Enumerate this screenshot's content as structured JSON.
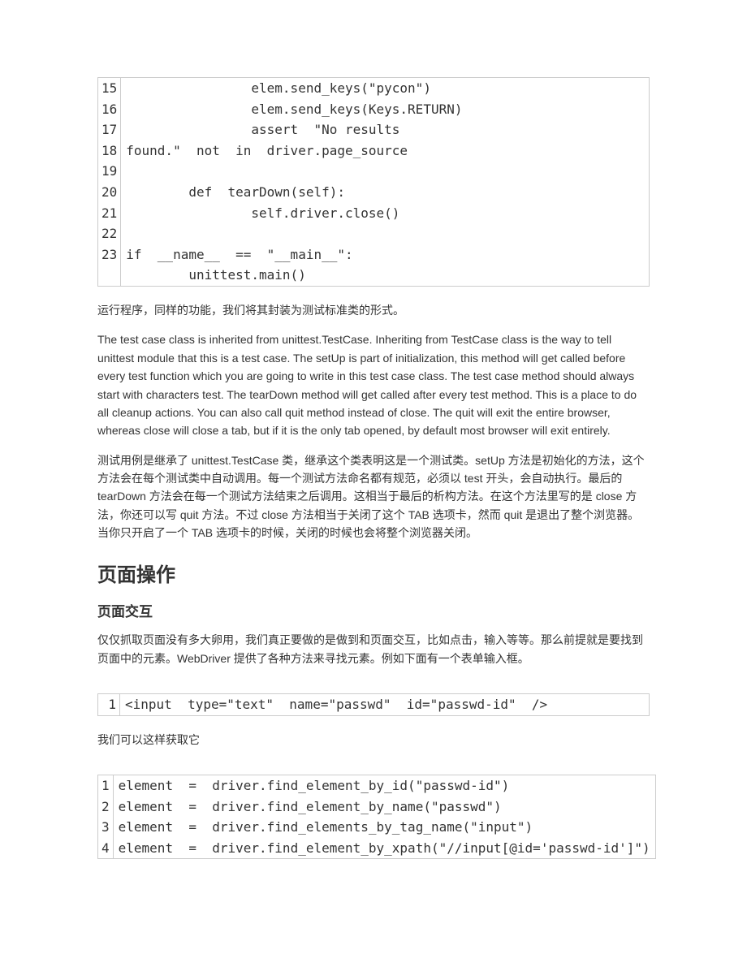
{
  "code1": {
    "start": 15,
    "lines": [
      "                elem.send_keys(\"pycon\")",
      "                elem.send_keys(Keys.RETURN)",
      "                assert  \"No results",
      "found.\"  not  in  driver.page_source",
      "",
      "        def  tearDown(self):",
      "                self.driver.close()",
      "",
      "if  __name__  ==  \"__main__\":",
      "        unittest.main()"
    ]
  },
  "para1": "运行程序，同样的功能，我们将其封装为测试标准类的形式。",
  "para2": "The test case class is inherited from unittest.TestCase. Inheriting from TestCase class is the way to tell unittest module that this is a test case. The setUp is part of initialization, this method will get called before every test function which you are going to write in this test case class. The test case method should always start with characters test. The tearDown method will get called after every test method. This is a place to do all cleanup actions. You can also call quit method instead of close. The quit will exit the entire browser, whereas close will close a tab, but if it is the only tab opened, by default most browser will exit entirely.",
  "para3": "测试用例是继承了 unittest.TestCase 类，继承这个类表明这是一个测试类。setUp 方法是初始化的方法，这个方法会在每个测试类中自动调用。每一个测试方法命名都有规范，必须以 test 开头，会自动执行。最后的 tearDown 方法会在每一个测试方法结束之后调用。这相当于最后的析构方法。在这个方法里写的是 close 方法，你还可以写 quit 方法。不过 close 方法相当于关闭了这个 TAB 选项卡，然而 quit 是退出了整个浏览器。当你只开启了一个 TAB 选项卡的时候，关闭的时候也会将整个浏览器关闭。",
  "h2a": "页面操作",
  "h3a": "页面交互",
  "para4": "仅仅抓取页面没有多大卵用，我们真正要做的是做到和页面交互，比如点击，输入等等。那么前提就是要找到页面中的元素。WebDriver 提供了各种方法来寻找元素。例如下面有一个表单输入框。",
  "code2": {
    "start": 1,
    "lines": [
      "<input  type=\"text\"  name=\"passwd\"  id=\"passwd-id\"  />"
    ]
  },
  "para5": "我们可以这样获取它",
  "code3": {
    "start": 1,
    "lines": [
      "element  =  driver.find_element_by_id(\"passwd-id\")",
      "element  =  driver.find_element_by_name(\"passwd\")",
      "element  =  driver.find_elements_by_tag_name(\"input\")",
      "element  =  driver.find_element_by_xpath(\"//input[@id='passwd-id']\")"
    ]
  }
}
